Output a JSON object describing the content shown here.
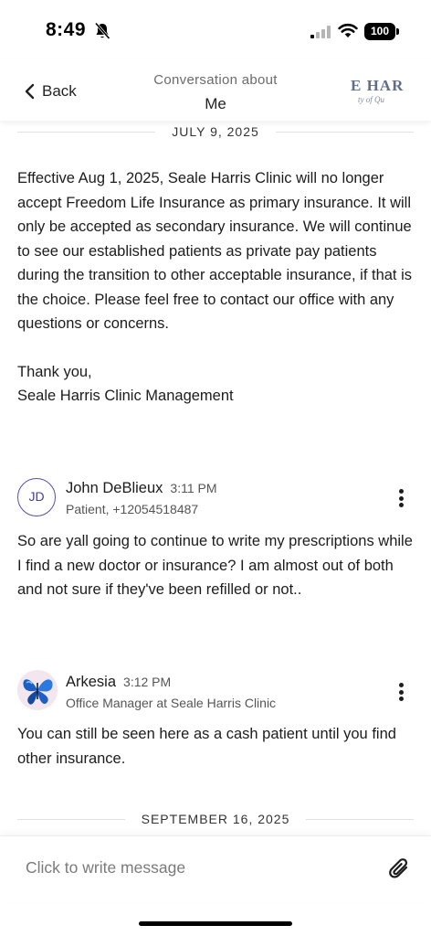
{
  "status_bar": {
    "time": "8:49",
    "battery": "100"
  },
  "header": {
    "back_label": "Back",
    "title": "Conversation about",
    "subtitle": "Me",
    "logo_text": "E HAR",
    "logo_subtext": "ty of Qu"
  },
  "divider_1": "JULY 9, 2025",
  "announcement": {
    "paragraph_1": "Effective Aug 1, 2025, Seale Harris Clinic will no longer accept Freedom Life Insurance as primary insurance. It will only be accepted as secondary insurance. We will continue to see our established patients as private pay patients during the transition to other acceptable insurance, if that is the choice. Please feel free to contact our office with any questions or concerns.",
    "paragraph_2": "Thank you,\nSeale Harris Clinic Management"
  },
  "messages": [
    {
      "initials": "JD",
      "name": "John DeBlieux",
      "time": "3:11 PM",
      "role": "Patient, +12054518487",
      "body": "So are yall going to continue to write my prescriptions while I find a new doctor or insurance? I am almost out of both and not sure if they've been refilled or not.."
    },
    {
      "name": "Arkesia",
      "time": "3:12 PM",
      "role": "Office Manager at Seale Harris Clinic",
      "body": "You can still be seen here as a cash patient until you find other insurance."
    }
  ],
  "divider_2": "SEPTEMBER 16, 2025",
  "composer": {
    "placeholder": "Click to write message"
  },
  "icons": {
    "back": "chevron-left-icon",
    "bell": "bell-slash-icon",
    "signal": "cellular-signal-icon",
    "wifi": "wifi-icon",
    "attach": "paperclip-icon",
    "more": "more-vertical-icon"
  },
  "colors": {
    "avatar_ring": "#5a4fa0",
    "text": "#1c1c1c",
    "muted": "#555555"
  }
}
